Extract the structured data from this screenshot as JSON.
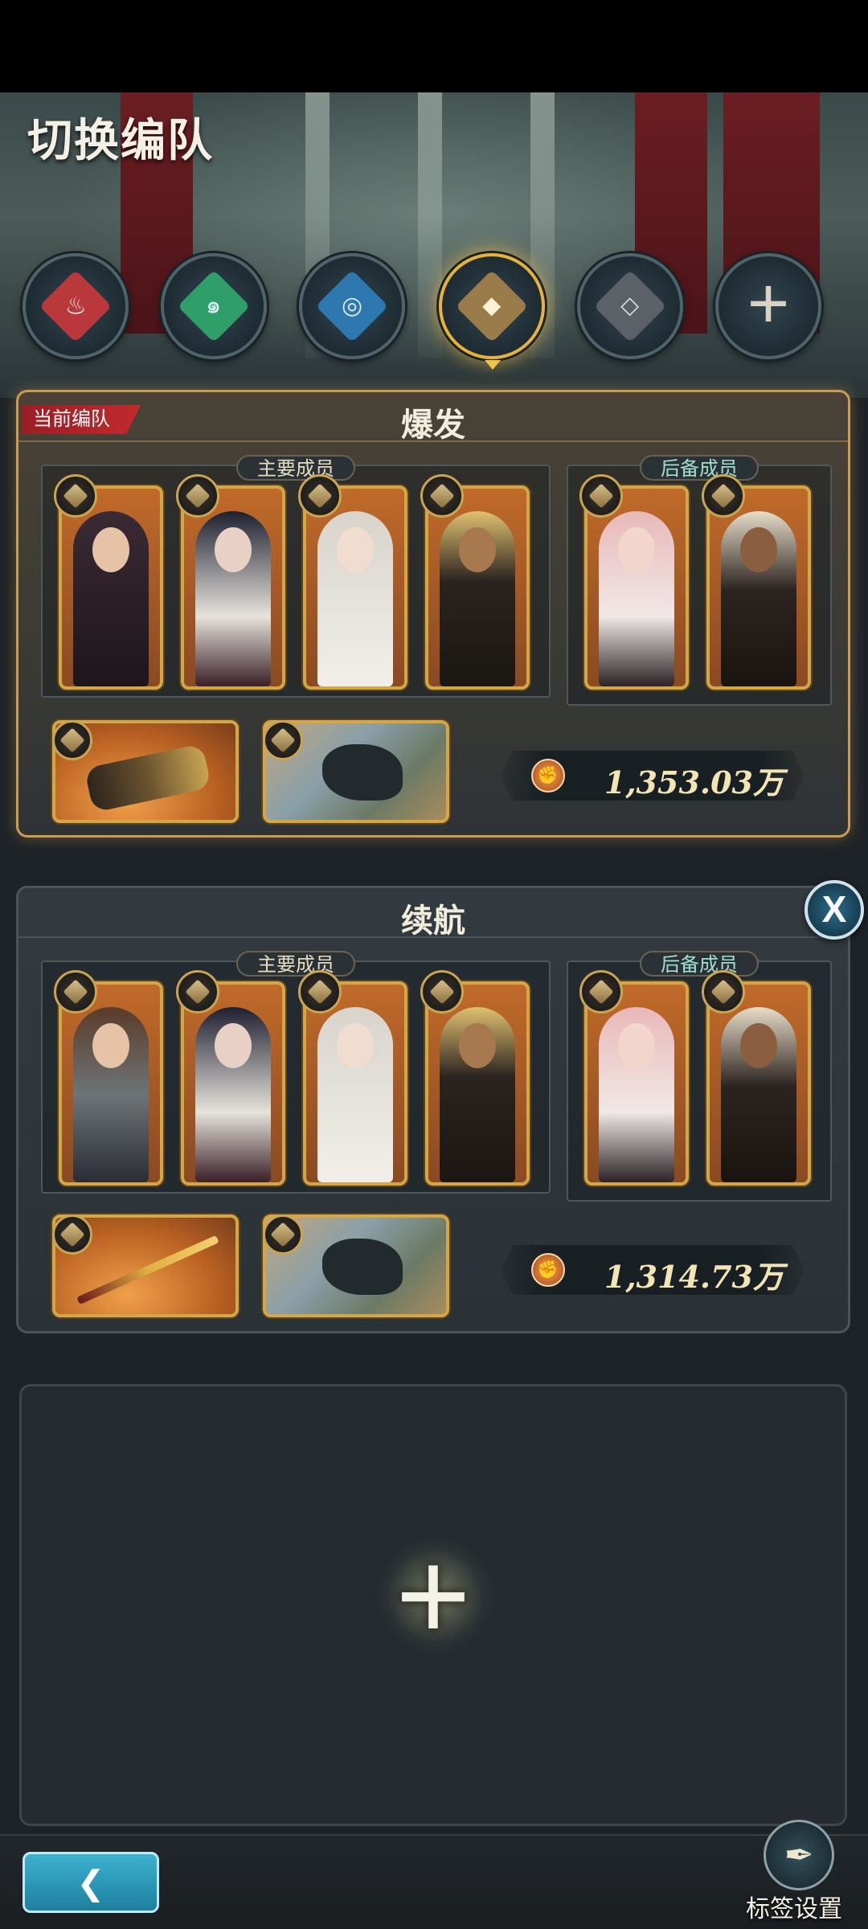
{
  "header": {
    "title": "切换编队"
  },
  "element_tabs": [
    {
      "name": "fire",
      "icon": "fire-diamond-icon",
      "color": "#d8484a",
      "active": false
    },
    {
      "name": "wind",
      "icon": "wind-diamond-icon",
      "color": "#3fbf80",
      "active": false
    },
    {
      "name": "water",
      "icon": "water-diamond-icon",
      "color": "#3e9ad8",
      "active": false
    },
    {
      "name": "earth",
      "icon": "earth-diamond-icon",
      "color": "#c8a36a",
      "active": true
    },
    {
      "name": "void",
      "icon": "void-diamond-icon",
      "color": "#8a8f96",
      "active": false
    },
    {
      "name": "add",
      "icon": "plus-icon",
      "color": "#d8d2c2",
      "active": false
    }
  ],
  "teams": [
    {
      "name": "爆发",
      "current_tag": "当前编队",
      "main_label": "主要成员",
      "reserve_label": "后备成员",
      "power": "1,353.03万"
    },
    {
      "name": "续航",
      "main_label": "主要成员",
      "reserve_label": "后备成员",
      "power": "1,314.73万",
      "close_label": "X"
    }
  ],
  "footer": {
    "back_icon": "back-arrow-icon",
    "tag_settings_label": "标签设置",
    "tag_settings_icon": "quill-icon"
  },
  "colors": {
    "accent_gold": "#d4a646",
    "current_tag_red": "#c12a2e",
    "back_button_cyan": "#3db2cf"
  }
}
